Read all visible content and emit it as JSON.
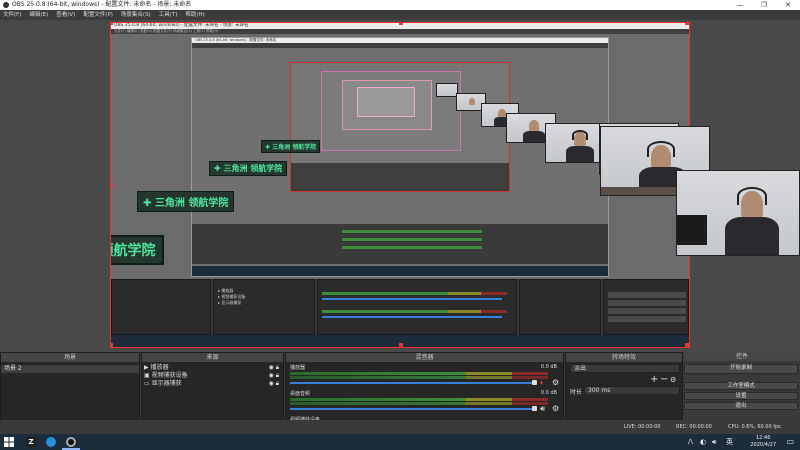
{
  "window": {
    "title": "OBS 25.0.8 (64-bit, windows) - 配置文件: 未命名 - 场景: 未命名",
    "controls": [
      "—",
      "❐",
      "✕"
    ]
  },
  "menu": [
    "文件(F)",
    "编辑(E)",
    "查看(V)",
    "配置文件(P)",
    "场景集合(S)",
    "工具(T)",
    "帮助(H)"
  ],
  "preview": {
    "logo_text": "三角洲 领航学院",
    "nested_title": "OBS 25.0.8 (64-bit, windows) - 配置文件: 未命名 - 场景: 未命名"
  },
  "docks": {
    "scenes": {
      "title": "场景",
      "items": [
        "场景 2"
      ]
    },
    "sources": {
      "title": "来源",
      "items": [
        "播放器",
        "视频捕获设备",
        "显示器捕获"
      ]
    },
    "mixer": {
      "title": "混音器",
      "channels": [
        {
          "name": "播放器",
          "db": "0.0 dB"
        },
        {
          "name": "桌面音频",
          "db": "0.0 dB"
        },
        {
          "name": "视频捕获设备",
          "db": ""
        }
      ]
    },
    "transitions": {
      "title": "转场特效",
      "type": "淡出",
      "duration_label": "时长",
      "duration_value": "300 ms"
    },
    "controls": {
      "title": "控件",
      "buttons": [
        "开始录制",
        "工作室模式",
        "设置",
        "退出"
      ]
    }
  },
  "status": {
    "live": "LIVE: 00:00:00",
    "rec": "REC: 00:00:00",
    "cpu": "CPU: 0.6%, 60.00 fps"
  },
  "taskbar": {
    "lang": "英",
    "time": "12:46",
    "date": "2020/4/27"
  },
  "colors": {
    "selection": "#e33333",
    "logo_green": "#4fe3a0",
    "slider_blue": "#3a7fd6",
    "taskbar": "#1d2c3a"
  }
}
